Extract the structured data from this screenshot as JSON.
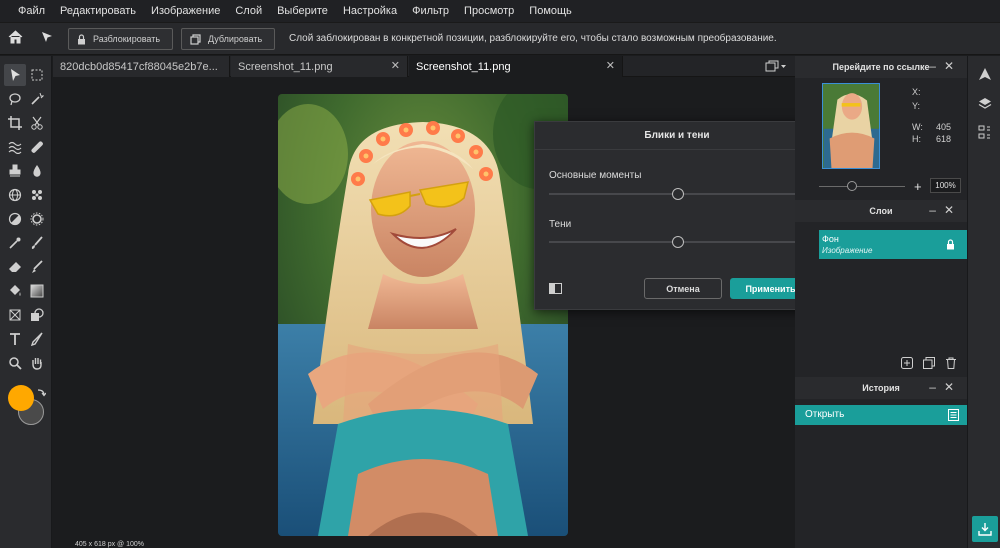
{
  "menu": [
    "Файл",
    "Редактировать",
    "Изображение",
    "Слой",
    "Выберите",
    "Настройка",
    "Фильтр",
    "Просмотр",
    "Помощь"
  ],
  "options": {
    "unlock_label": "Разблокировать",
    "duplicate_label": "Дублировать",
    "message": "Слой заблокирован в конкретной позиции, разблокируйте его, чтобы стало возможным преобразование."
  },
  "tabs": [
    {
      "label": "820dcb0d85417cf88045e2b7e..."
    },
    {
      "label": "Screenshot_11.png"
    },
    {
      "label": "Screenshot_11.png"
    }
  ],
  "status": "405 x 618 px @ 100%",
  "dialog": {
    "title": "Блики и тени",
    "highlights_label": "Основные моменты",
    "highlights_value": "0",
    "shadows_label": "Тени",
    "shadows_value": "0",
    "cancel": "Отмена",
    "apply": "Применить"
  },
  "navigator": {
    "title": "Перейдите по ссылке",
    "x_label": "X:",
    "y_label": "Y:",
    "w_label": "W:",
    "h_label": "H:",
    "w_value": "405",
    "h_value": "618",
    "zoom": "100%"
  },
  "layers": {
    "title": "Слои",
    "items": [
      {
        "name": "Фон",
        "type": "Изображение"
      }
    ]
  },
  "history": {
    "title": "История",
    "items": [
      {
        "label": "Открыть"
      }
    ]
  },
  "colors": {
    "accent": "#1a9e9a",
    "foreground": "#ffa800",
    "background": "#4a4a4a"
  }
}
